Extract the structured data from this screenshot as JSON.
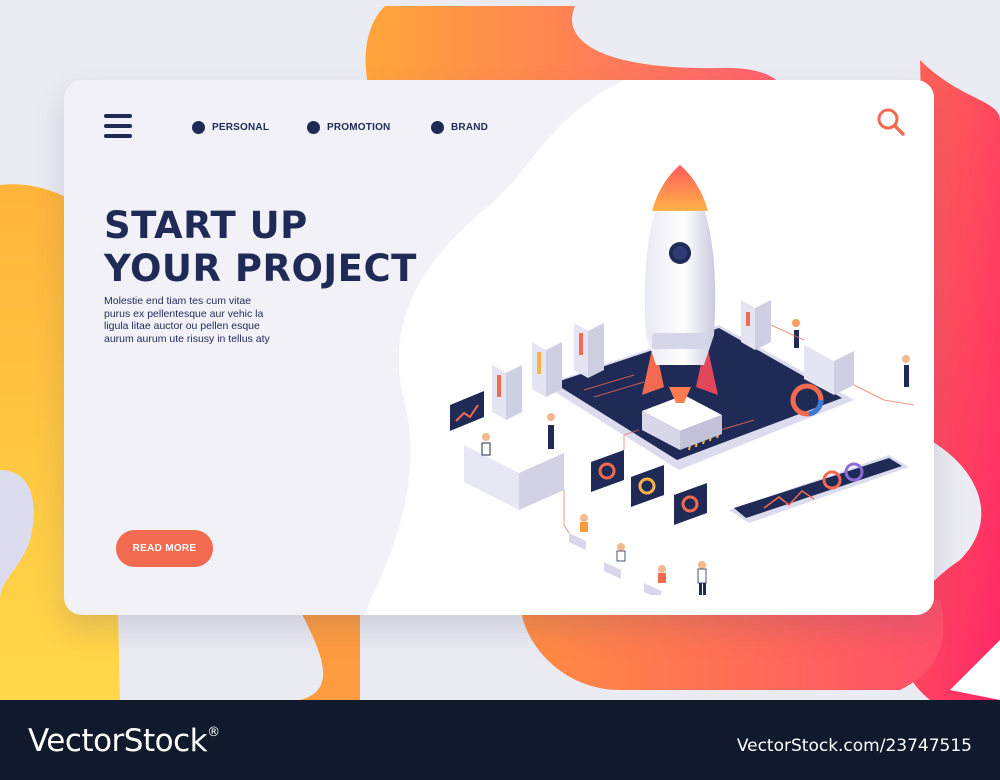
{
  "nav": {
    "items": [
      {
        "label": "PERSONAL"
      },
      {
        "label": "PROMOTION"
      },
      {
        "label": "BRAND"
      }
    ]
  },
  "hero": {
    "title_line1": "START UP",
    "title_line2": "YOUR PROJECT",
    "body": "Molestie end tiam tes cum vitae purus ex pellentesque aur vehic la ligula litae auctor ou pellen esque aurum aurum ute risusy in tellus aty",
    "cta_label": "READ MORE"
  },
  "footer": {
    "brand": "VectorStock",
    "registered": "®",
    "image_id": "VectorStock.com/23747515"
  },
  "colors": {
    "navy": "#1f2a57",
    "accent": "#f26a4f",
    "pink": "#ff2f6d",
    "orange": "#ff8a3d",
    "yellow": "#ffc93c",
    "footer_bg": "#111a2c"
  },
  "icons": [
    "menu-icon",
    "search-icon",
    "rocket-illustration"
  ]
}
